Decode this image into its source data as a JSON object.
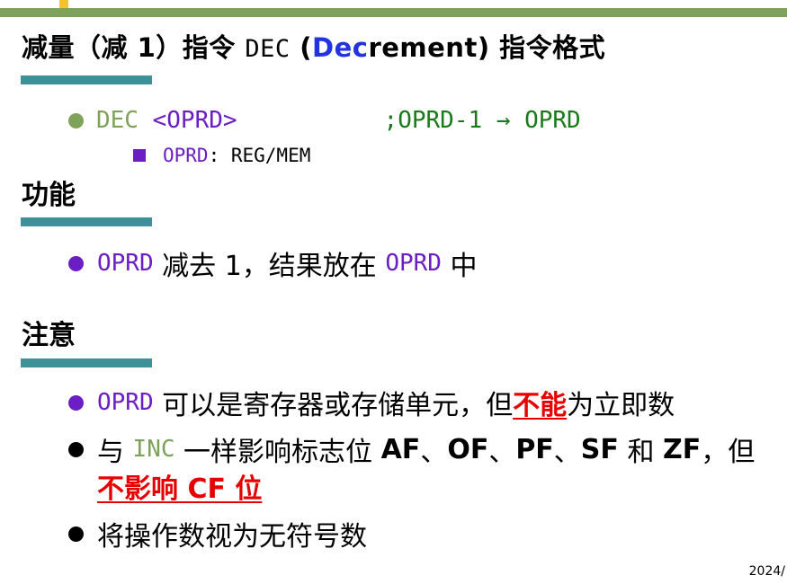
{
  "slide": {
    "title": {
      "prefix": "减量（减 1）指令 ",
      "mnemonic": "DEC",
      "paren_open": " (",
      "highlight": "Dec",
      "rest": "rement)",
      "suffix": " 指令格式"
    },
    "syntax": {
      "mnemonic": "DEC",
      "operand": " <OPRD>",
      "comment": ";OPRD-1 → OPRD",
      "sub_label": "OPRD",
      "sub_value": ": REG/MEM"
    },
    "function": {
      "heading": "功能",
      "operand": "OPRD",
      "text_a": " 减去 1，结果放在 ",
      "operand2": "OPRD",
      "text_b": " 中"
    },
    "notes": {
      "heading": "注意",
      "item1": {
        "operand": "OPRD",
        "text_a": " 可以是寄存器或存储单元，但",
        "red": "不能",
        "text_b": "为立即数"
      },
      "item2": {
        "a": "与 ",
        "inc": "INC",
        "b": " 一样影响标志位 ",
        "f1": "AF",
        "s1": "、",
        "f2": "OF",
        "s2": "、",
        "f3": "PF",
        "s3": "、",
        "f4": "SF",
        "c": " 和 ",
        "f5": "ZF",
        "d": "，但",
        "red": "不影响 CF 位"
      },
      "item3": {
        "text": "将操作数视为无符号数"
      }
    },
    "footer": {
      "date": "2024/"
    }
  }
}
